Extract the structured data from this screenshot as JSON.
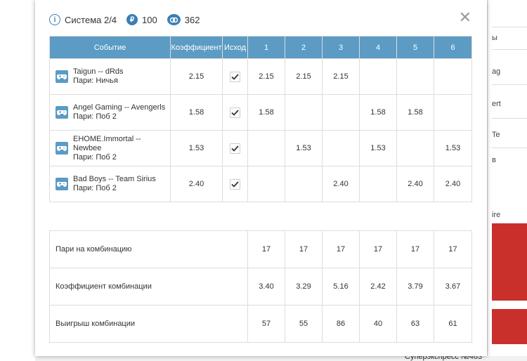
{
  "header": {
    "system_label": "Система 2/4",
    "stake": "100",
    "balance": "362"
  },
  "table": {
    "columns": [
      "Событие",
      "Коэффициент",
      "Исход",
      "1",
      "2",
      "3",
      "4",
      "5",
      "6"
    ],
    "rows": [
      {
        "event": "Taigun -- dRds",
        "bet": "Пари: Ничья",
        "coef": "2.15",
        "cells": [
          "2.15",
          "2.15",
          "2.15",
          "",
          "",
          ""
        ]
      },
      {
        "event": "Angel Gaming -- Avengerls",
        "bet": "Пари: Поб 2",
        "coef": "1.58",
        "cells": [
          "1.58",
          "",
          "",
          "1.58",
          "1.58",
          ""
        ]
      },
      {
        "event": "EHOME.Immortal -- Newbee",
        "bet": "Пари: Поб 2",
        "coef": "1.53",
        "cells": [
          "",
          "1.53",
          "",
          "1.53",
          "",
          "1.53"
        ]
      },
      {
        "event": "Bad Boys -- Team Sirius",
        "bet": "Пари: Поб 2",
        "coef": "2.40",
        "cells": [
          "",
          "",
          "2.40",
          "",
          "2.40",
          "2.40"
        ]
      }
    ]
  },
  "summary": [
    {
      "label": "Пари на комбинацию",
      "values": [
        "17",
        "17",
        "17",
        "17",
        "17",
        "17"
      ]
    },
    {
      "label": "Коэффициент комбинации",
      "values": [
        "3.40",
        "3.29",
        "5.16",
        "2.42",
        "3.79",
        "3.67"
      ]
    },
    {
      "label": "Выигрыш комбинации",
      "values": [
        "57",
        "55",
        "86",
        "40",
        "63",
        "61"
      ]
    }
  ],
  "background": {
    "side_texts": [
      "ы",
      "ag",
      "ert",
      "Te",
      "в",
      "ire"
    ],
    "bottom_text": "Суперэкспресс №463"
  },
  "colors": {
    "accent": "#5b9bc4",
    "icon_blue": "#3a7fb5"
  }
}
